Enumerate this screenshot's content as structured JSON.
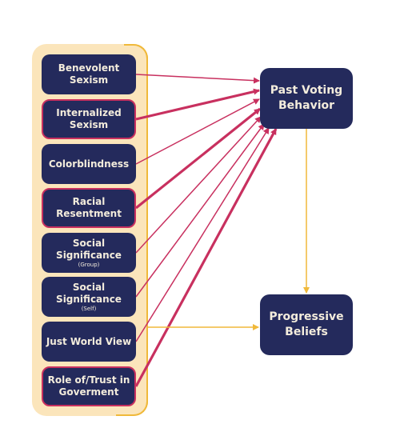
{
  "diagram": {
    "predictors": [
      {
        "id": "benevolent-sexism",
        "lines": [
          "Benevolent",
          "Sexism"
        ],
        "sub": "",
        "strong": false
      },
      {
        "id": "internalized-sexism",
        "lines": [
          "Internalized",
          "Sexism"
        ],
        "sub": "",
        "strong": true
      },
      {
        "id": "colorblindness",
        "lines": [
          "Colorblindness"
        ],
        "sub": "",
        "strong": false
      },
      {
        "id": "racial-resentment",
        "lines": [
          "Racial",
          "Resentment"
        ],
        "sub": "",
        "strong": true
      },
      {
        "id": "social-significance-group",
        "lines": [
          "Social",
          "Significance"
        ],
        "sub": "(Group)",
        "strong": false
      },
      {
        "id": "social-significance-self",
        "lines": [
          "Social",
          "Significance"
        ],
        "sub": "(Self)",
        "strong": false
      },
      {
        "id": "just-world-view",
        "lines": [
          "Just World View"
        ],
        "sub": "",
        "strong": false
      },
      {
        "id": "role-trust-government",
        "lines": [
          "Role of/Trust in",
          "Goverment"
        ],
        "sub": "",
        "strong": true
      }
    ],
    "outcomes": [
      {
        "id": "past-voting-behavior",
        "lines": [
          "Past Voting",
          "Behavior"
        ]
      },
      {
        "id": "progressive-beliefs",
        "lines": [
          "Progressive",
          "Beliefs"
        ]
      }
    ],
    "edges": [
      {
        "from": "benevolent-sexism",
        "to": "past-voting-behavior",
        "weight": "thin"
      },
      {
        "from": "internalized-sexism",
        "to": "past-voting-behavior",
        "weight": "thick"
      },
      {
        "from": "colorblindness",
        "to": "past-voting-behavior",
        "weight": "thin"
      },
      {
        "from": "racial-resentment",
        "to": "past-voting-behavior",
        "weight": "thick"
      },
      {
        "from": "social-significance-group",
        "to": "past-voting-behavior",
        "weight": "thin"
      },
      {
        "from": "social-significance-self",
        "to": "past-voting-behavior",
        "weight": "thin"
      },
      {
        "from": "just-world-view",
        "to": "past-voting-behavior",
        "weight": "thin"
      },
      {
        "from": "role-trust-government",
        "to": "past-voting-behavior",
        "weight": "thick"
      },
      {
        "from": "predictor-group",
        "to": "progressive-beliefs",
        "weight": "thin"
      },
      {
        "from": "past-voting-behavior",
        "to": "progressive-beliefs",
        "weight": "thin"
      }
    ],
    "colors": {
      "box": "#242A5C",
      "box_text": "#F3ECDC",
      "predictor_edge": "#C8305F",
      "outcome_edge": "#F0B93A",
      "group_fill": "#FBE5BB"
    }
  }
}
